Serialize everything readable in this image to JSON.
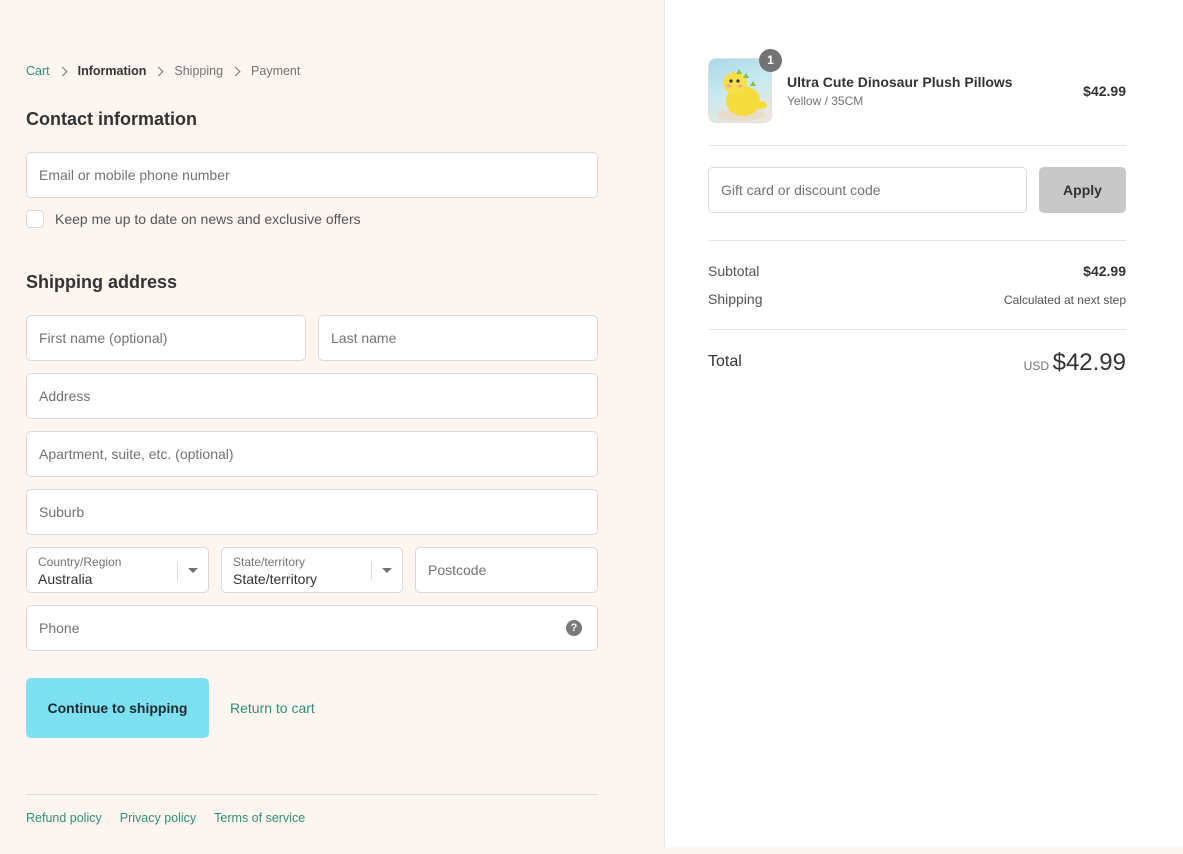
{
  "breadcrumb": {
    "cart": "Cart",
    "information": "Information",
    "shipping": "Shipping",
    "payment": "Payment"
  },
  "contact": {
    "title": "Contact information",
    "email_placeholder": "Email or mobile phone number",
    "newsletter_label": "Keep me up to date on news and exclusive offers"
  },
  "shipping_address": {
    "title": "Shipping address",
    "first_name_placeholder": "First name (optional)",
    "last_name_placeholder": "Last name",
    "address_placeholder": "Address",
    "apartment_placeholder": "Apartment, suite, etc. (optional)",
    "suburb_placeholder": "Suburb",
    "country_label": "Country/Region",
    "country_value": "Australia",
    "state_label": "State/territory",
    "state_value": "State/territory",
    "postcode_placeholder": "Postcode",
    "phone_placeholder": "Phone",
    "phone_help_icon": "?"
  },
  "actions": {
    "continue_label": "Continue to shipping",
    "return_label": "Return to cart"
  },
  "footer": {
    "refund": "Refund policy",
    "privacy": "Privacy policy",
    "terms": "Terms of service"
  },
  "order_summary": {
    "item": {
      "quantity": "1",
      "name": "Ultra Cute Dinosaur Plush Pillows",
      "variant": "Yellow / 35CM",
      "price": "$42.99",
      "image_icon": "yellow-dinosaur-plush-image"
    },
    "discount_placeholder": "Gift card or discount code",
    "apply_label": "Apply",
    "subtotal_label": "Subtotal",
    "subtotal_value": "$42.99",
    "shipping_label": "Shipping",
    "shipping_value": "Calculated at next step",
    "total_label": "Total",
    "currency": "USD",
    "total_value": "$42.99"
  },
  "colors": {
    "accent_link": "#2f8f7a",
    "primary_button": "#7ce0f0",
    "left_background": "#fdf6f0",
    "apply_button": "#c8c8c8"
  }
}
